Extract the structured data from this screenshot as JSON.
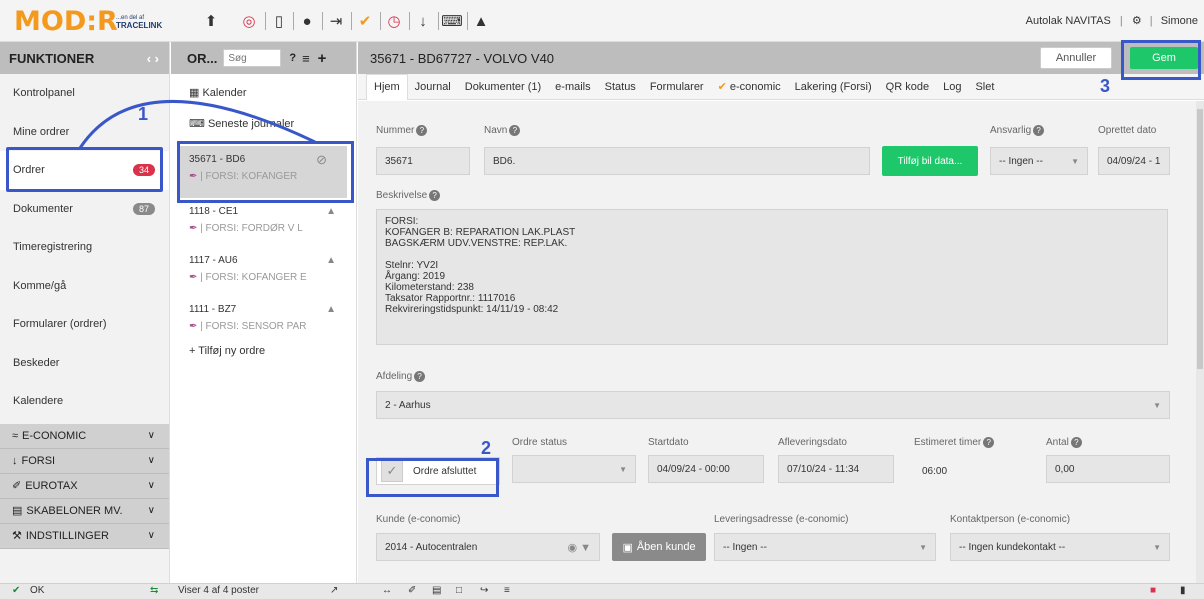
{
  "app": {
    "logo_text": "MOD:R",
    "logo_sub1": "...en del af",
    "logo_sub2": "TRACELINK",
    "company": "Autolak NAVITAS",
    "user": "Simone",
    "separator": "|"
  },
  "toolbar_icons": [
    "upload-icon",
    "lifebuoy-icon",
    "phone-icon",
    "chat-icon",
    "logout-icon",
    "economic-icon",
    "timer-icon",
    "forsi-icon",
    "keyboard-icon",
    "warning-icon"
  ],
  "sidebar": {
    "title": "FUNKTIONER",
    "nav": "‹ ›",
    "items": [
      {
        "label": "Kontrolpanel"
      },
      {
        "label": "Mine ordrer"
      },
      {
        "label": "Ordrer",
        "badge": "34",
        "badge_color": "#d9324a"
      },
      {
        "label": "Dokumenter",
        "badge": "87",
        "badge_color": "#8a8a8a"
      },
      {
        "label": "Timeregistrering"
      },
      {
        "label": "Komme/gå"
      },
      {
        "label": "Formularer (ordrer)"
      },
      {
        "label": "Beskeder"
      },
      {
        "label": "Kalendere"
      }
    ],
    "categories": [
      {
        "label": "E-CONOMIC",
        "icon": "economic-icon"
      },
      {
        "label": "FORSI",
        "icon": "forsi-icon"
      },
      {
        "label": "EUROTAX",
        "icon": "eurotax-icon"
      },
      {
        "label": "SKABELONER MV.",
        "icon": "template-icon"
      },
      {
        "label": "INDSTILLINGER",
        "icon": "tools-icon"
      }
    ],
    "status": "OK"
  },
  "orderlist": {
    "title": "OR...",
    "search_placeholder": "Søg",
    "help": "?",
    "add": "+",
    "calendar_label": "Kalender",
    "journals_label": "Seneste journaler",
    "orders": [
      {
        "title": "35671 - BD6",
        "sub": "| FORSI: KOFANGER",
        "selected": true,
        "status_icon": "no-entry-icon"
      },
      {
        "title": "1118 - CE1",
        "sub": "| FORSI: FORDØR V L",
        "status_icon": "lock-icon"
      },
      {
        "title": "1117 - AU6",
        "sub": "| FORSI: KOFANGER E",
        "status_icon": "lock-icon"
      },
      {
        "title": "1111 - BZ7",
        "sub": "| FORSI: SENSOR PAR",
        "status_icon": "lock-icon"
      }
    ],
    "add_order": "+ Tilføj ny ordre",
    "footer": "Viser 4 af 4 poster"
  },
  "main": {
    "title": "35671 - BD67727 - VOLVO V40",
    "cancel": "Annuller",
    "save": "Gem",
    "tabs": [
      "Hjem",
      "Journal",
      "Dokumenter (1)",
      "e-mails",
      "Status",
      "Formularer",
      "e-conomic",
      "Lakering (Forsi)",
      "QR kode",
      "Log",
      "Slet"
    ],
    "fields": {
      "nummer_label": "Nummer",
      "nummer_value": "35671",
      "navn_label": "Navn",
      "navn_value": "BD6.",
      "add_car_button": "Tilføj bil data...",
      "ansvarlig_label": "Ansvarlig",
      "ansvarlig_value": "-- Ingen --",
      "oprettet_label": "Oprettet dato",
      "oprettet_value": "04/09/24 - 1",
      "beskrivelse_label": "Beskrivelse",
      "beskrivelse_value": "FORSI:\nKOFANGER B: REPARATION LAK.PLAST\nBAGSKÆRM UDV.VENSTRE: REP.LAK.\n\nStelnr: YV2I\nÅrgang: 2019\nKilometerstand: 238\nTaksator Rapportnr.: 1117016\nRekvireringstidspunkt: 14/11/19 - 08:42",
      "afdeling_label": "Afdeling",
      "afdeling_value": "2 - Aarhus",
      "ordre_afsluttet_label": "Ordre afsluttet",
      "ordre_status_label": "Ordre status",
      "ordre_status_value": "",
      "startdato_label": "Startdato",
      "startdato_value": "04/09/24 - 00:00",
      "aflevering_label": "Afleveringsdato",
      "aflevering_value": "07/10/24 - 11:34",
      "estimeret_label": "Estimeret timer",
      "estimeret_value": "06:00",
      "antal_label": "Antal",
      "antal_value": "0,00",
      "kunde_label": "Kunde (e-conomic)",
      "kunde_value": "2014 - Autocentralen",
      "aaben_kunde": "Åben kunde",
      "levering_label": "Leveringsadresse (e-conomic)",
      "levering_value": "-- Ingen --",
      "kontakt_label": "Kontaktperson (e-conomic)",
      "kontakt_value": "-- Ingen kundekontakt --"
    }
  },
  "annotations": [
    "1",
    "2",
    "3"
  ],
  "colors": {
    "accent_green": "#1ec86a",
    "annotation_blue": "#3a57c9",
    "badge_red": "#d9324a",
    "logo_orange": "#f39a1e"
  }
}
